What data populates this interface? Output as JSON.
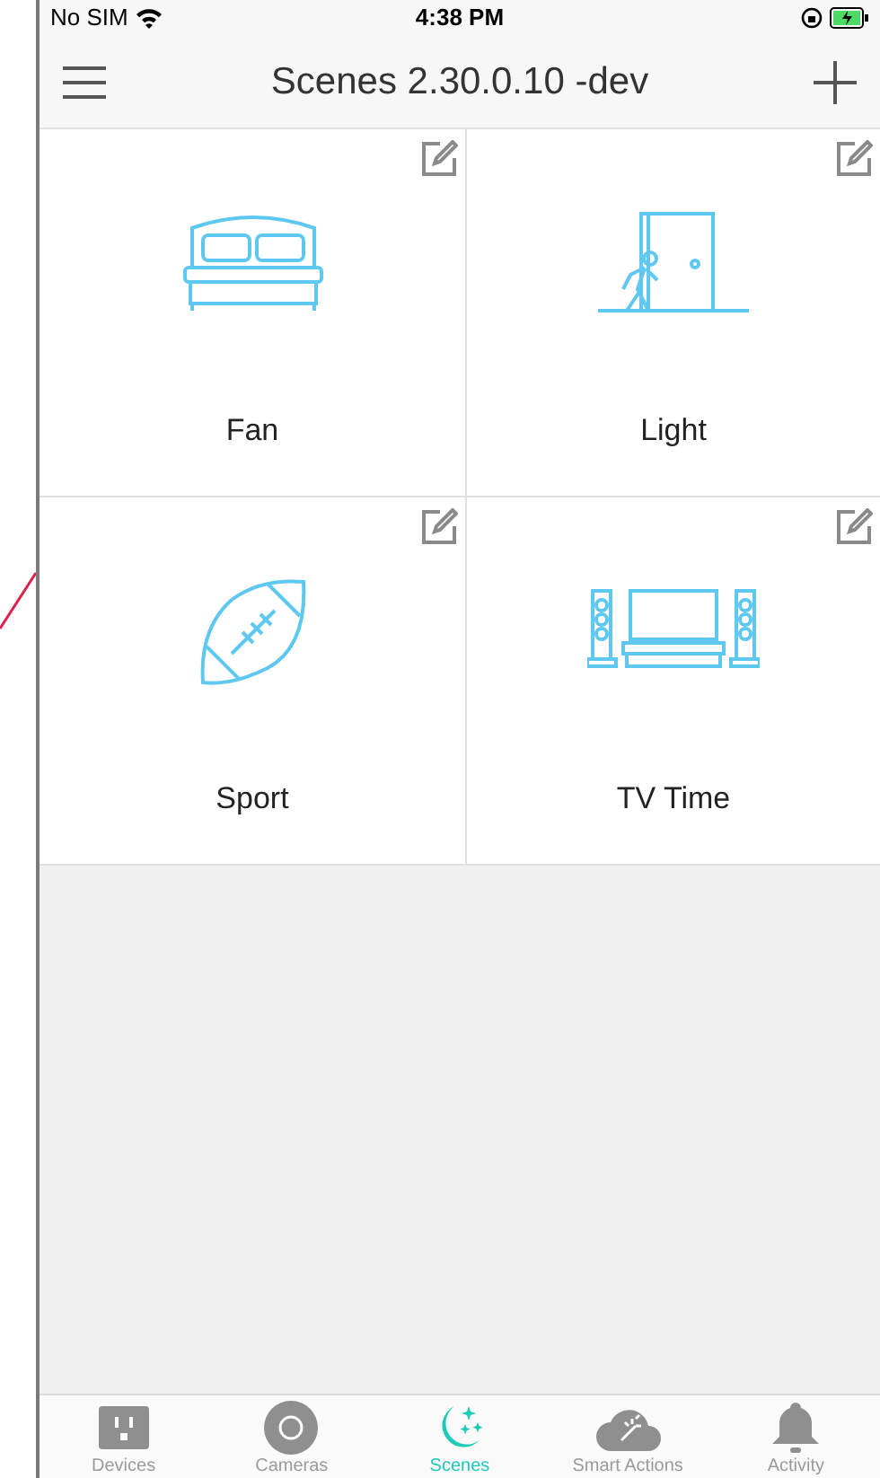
{
  "status_bar": {
    "carrier": "No SIM",
    "time": "4:38 PM"
  },
  "nav": {
    "title": "Scenes 2.30.0.10 -dev"
  },
  "scenes": [
    {
      "name": "Fan",
      "kind": "bed"
    },
    {
      "name": "Light",
      "kind": "door"
    },
    {
      "name": "Sport",
      "kind": "football"
    },
    {
      "name": "TV Time",
      "kind": "tv"
    }
  ],
  "tabs": [
    {
      "label": "Devices",
      "kind": "outlet",
      "selected": false
    },
    {
      "label": "Cameras",
      "kind": "camera",
      "selected": false
    },
    {
      "label": "Scenes",
      "kind": "moon",
      "selected": true
    },
    {
      "label": "Smart Actions",
      "kind": "cloud",
      "selected": false
    },
    {
      "label": "Activity",
      "kind": "bell",
      "selected": false
    }
  ]
}
